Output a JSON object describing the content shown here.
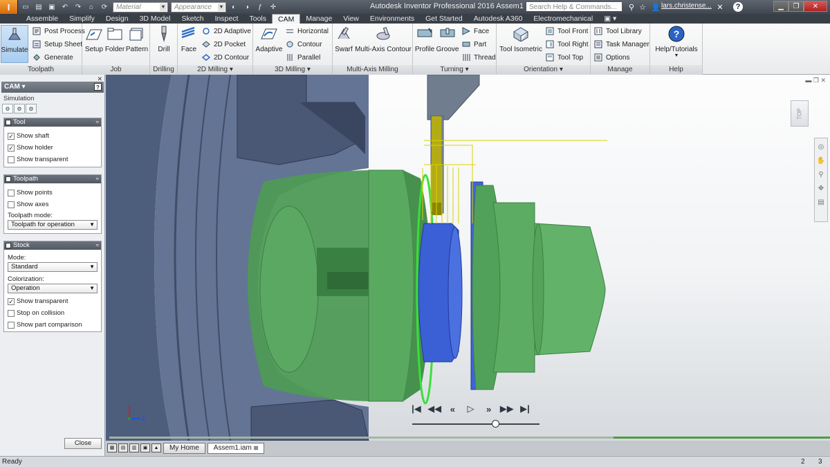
{
  "titlebar": {
    "app_badge": "I",
    "material_placeholder": "Material",
    "appearance_placeholder": "Appearance",
    "app_title": "Autodesk Inventor Professional 2016    Assem1",
    "search_placeholder": "Search Help & Commands...",
    "user": "lars.christense...",
    "help_label": "?"
  },
  "tabs": [
    "Assemble",
    "Simplify",
    "Design",
    "3D Model",
    "Sketch",
    "Inspect",
    "Tools",
    "CAM",
    "Manage",
    "View",
    "Environments",
    "Get Started",
    "Autodesk A360",
    "Electromechanical"
  ],
  "active_tab": "CAM",
  "ribbon": {
    "toolpath": {
      "title": "Toolpath",
      "simulate": "Simulate",
      "post_process": "Post Process",
      "setup_sheet": "Setup Sheet",
      "generate": "Generate"
    },
    "job": {
      "title": "Job",
      "setup": "Setup",
      "folder": "Folder",
      "pattern": "Pattern"
    },
    "drilling": {
      "title": "Drilling",
      "drill": "Drill"
    },
    "milling2d": {
      "title": "2D Milling",
      "face": "Face",
      "adaptive2d": "2D Adaptive",
      "pocket2d": "2D Pocket",
      "contour2d": "2D Contour"
    },
    "milling3d": {
      "title": "3D Milling",
      "adaptive": "Adaptive",
      "horizontal": "Horizontal",
      "contour": "Contour",
      "parallel": "Parallel"
    },
    "multiaxis": {
      "title": "Multi-Axis Milling",
      "swarf": "Swarf",
      "multiaxis_contour": "Multi-Axis Contour"
    },
    "turning": {
      "title": "Turning",
      "profile": "Profile",
      "groove": "Groove",
      "face": "Face",
      "part": "Part",
      "thread": "Thread"
    },
    "orientation": {
      "title": "Orientation",
      "tool_isometric": "Tool Isometric",
      "tool_front": "Tool Front",
      "tool_right": "Tool Right",
      "tool_top": "Tool Top"
    },
    "manage": {
      "title": "Manage",
      "tool_library": "Tool Library",
      "task_manager": "Task Manager",
      "options": "Options"
    },
    "help": {
      "title": "Help",
      "help_tutorials": "Help/Tutorials"
    }
  },
  "left_panel": {
    "header": "CAM",
    "subtitle": "Simulation",
    "tool_group": {
      "title": "Tool",
      "show_shaft": "Show shaft",
      "show_holder": "Show holder",
      "show_transparent": "Show transparent"
    },
    "toolpath_group": {
      "title": "Toolpath",
      "show_points": "Show points",
      "show_axes": "Show axes",
      "mode_label": "Toolpath mode:",
      "mode_value": "Toolpath for operation"
    },
    "stock_group": {
      "title": "Stock",
      "mode_label": "Mode:",
      "mode_value": "Standard",
      "colorization_label": "Colorization:",
      "colorization_value": "Operation",
      "show_transparent": "Show transparent",
      "stop_on_collision": "Stop on collision",
      "show_part_comparison": "Show part comparison"
    },
    "close": "Close"
  },
  "viewport": {
    "viewcube_label": "TOP",
    "progress_fraction": 0.7,
    "slider_fraction": 0.65,
    "triad_z": "Z"
  },
  "doc_tabs": {
    "home": "My Home",
    "file": "Assem1.iam"
  },
  "status": {
    "text": "Ready",
    "n1": "2",
    "n2": "3"
  },
  "colors": {
    "stock_green": "#55a35a",
    "part_blue": "#3a5fd0",
    "fixture_gray": "#5f6f8e",
    "tool_yellow": "#c8c000"
  }
}
